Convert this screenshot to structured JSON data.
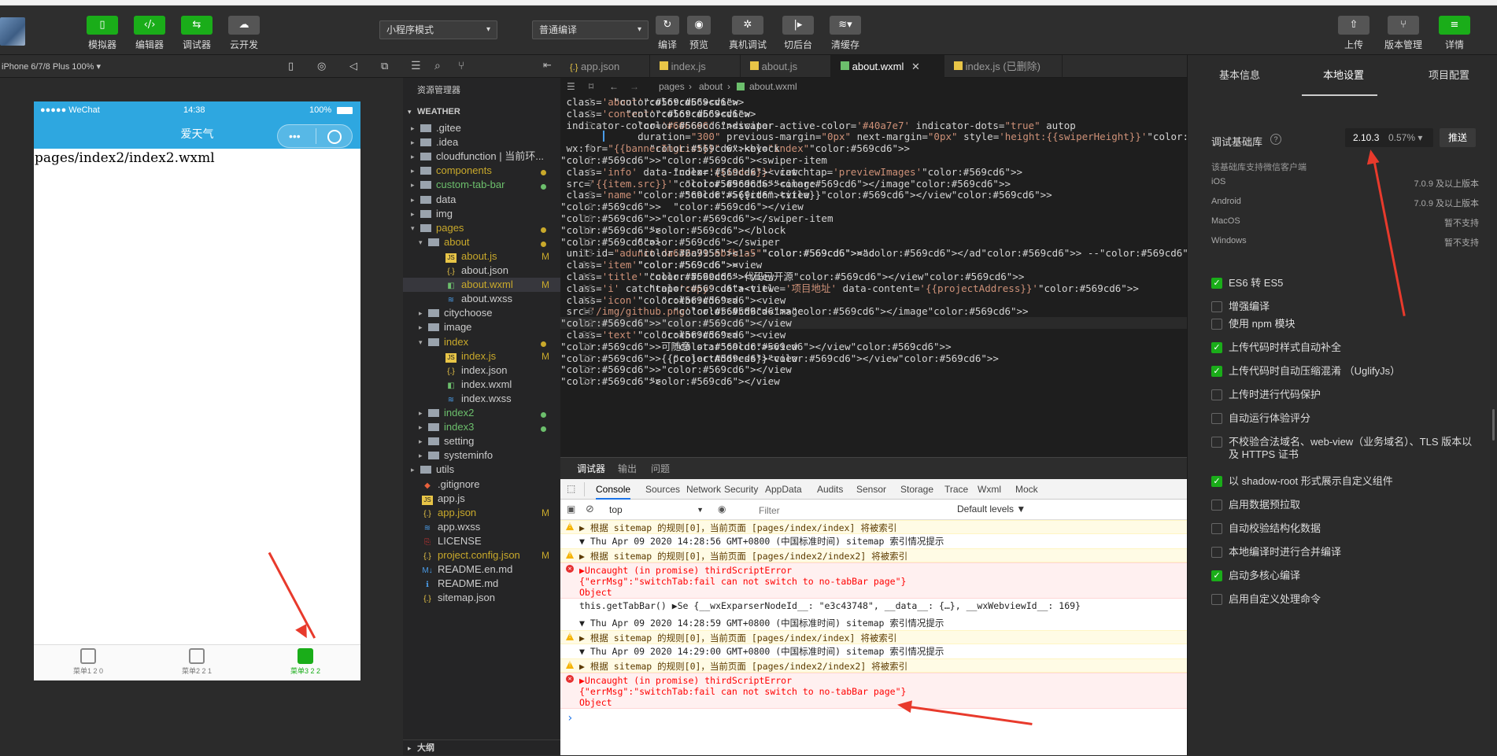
{
  "toolbar": {
    "left_buttons": [
      {
        "label": "模拟器",
        "icon": "phone-icon"
      },
      {
        "label": "编辑器",
        "icon": "code-icon"
      },
      {
        "label": "调试器",
        "icon": "debug-icon"
      },
      {
        "label": "云开发",
        "icon": "cloud-icon"
      }
    ],
    "mode_select": "小程序模式",
    "compile_select": "普通编译",
    "mid_buttons": [
      {
        "label": "编译",
        "icon": "refresh-icon"
      },
      {
        "label": "预览",
        "icon": "eye-icon"
      },
      {
        "label": "真机调试",
        "icon": "bug-icon"
      },
      {
        "label": "切后台",
        "icon": "switch-icon"
      },
      {
        "label": "清缓存",
        "icon": "layers-icon"
      }
    ],
    "right_buttons": [
      {
        "label": "上传",
        "icon": "upload-icon"
      },
      {
        "label": "版本管理",
        "icon": "branch-icon"
      },
      {
        "label": "详情",
        "icon": "menu-icon"
      }
    ]
  },
  "simulator": {
    "device": "iPhone 6/7/8 Plus 100% ▾",
    "status_left": "●●●●● WeChat",
    "status_time": "14:38",
    "status_battery": "100%",
    "nav_title": "爱天气",
    "page_text": "pages/index2/index2.wxml",
    "tabs": [
      {
        "label": "菜单1 2 0"
      },
      {
        "label": "菜单2 2 1"
      },
      {
        "label": "菜单3 2 2"
      }
    ]
  },
  "explorer": {
    "title": "资源管理器",
    "root": "WEATHER",
    "items": [
      {
        "name": ".gitee",
        "type": "folder",
        "depth": 1
      },
      {
        "name": ".idea",
        "type": "folder",
        "depth": 1
      },
      {
        "name": "cloudfunction | 当前环...",
        "type": "folder",
        "depth": 1
      },
      {
        "name": "components",
        "type": "folder",
        "depth": 1,
        "color": "#c9a92b"
      },
      {
        "name": "custom-tab-bar",
        "type": "folder",
        "depth": 1,
        "color": "#6cbf6c"
      },
      {
        "name": "data",
        "type": "folder",
        "depth": 1
      },
      {
        "name": "img",
        "type": "folder",
        "depth": 1
      },
      {
        "name": "pages",
        "type": "folder",
        "depth": 1,
        "color": "#c9a92b",
        "open": true
      },
      {
        "name": "about",
        "type": "folder",
        "depth": 2,
        "color": "#c9a92b",
        "open": true
      },
      {
        "name": "about.js",
        "type": "js",
        "depth": 3,
        "color": "#c9a92b",
        "badge": "M"
      },
      {
        "name": "about.json",
        "type": "json",
        "depth": 3
      },
      {
        "name": "about.wxml",
        "type": "wxml",
        "depth": 3,
        "color": "#c9a92b",
        "badge": "M",
        "selected": true
      },
      {
        "name": "about.wxss",
        "type": "wxss",
        "depth": 3
      },
      {
        "name": "citychoose",
        "type": "folder",
        "depth": 2
      },
      {
        "name": "image",
        "type": "folder",
        "depth": 2
      },
      {
        "name": "index",
        "type": "folder",
        "depth": 2,
        "color": "#c9a92b",
        "open": true
      },
      {
        "name": "index.js",
        "type": "js",
        "depth": 3,
        "color": "#c9a92b",
        "badge": "M"
      },
      {
        "name": "index.json",
        "type": "json",
        "depth": 3
      },
      {
        "name": "index.wxml",
        "type": "wxml",
        "depth": 3
      },
      {
        "name": "index.wxss",
        "type": "wxss",
        "depth": 3
      },
      {
        "name": "index2",
        "type": "folder",
        "depth": 2,
        "color": "#6cbf6c"
      },
      {
        "name": "index3",
        "type": "folder",
        "depth": 2,
        "color": "#6cbf6c"
      },
      {
        "name": "setting",
        "type": "folder",
        "depth": 2
      },
      {
        "name": "systeminfo",
        "type": "folder",
        "depth": 2
      },
      {
        "name": "utils",
        "type": "folder",
        "depth": 1
      },
      {
        "name": ".gitignore",
        "type": "git",
        "depth": 1
      },
      {
        "name": "app.js",
        "type": "js",
        "depth": 1
      },
      {
        "name": "app.json",
        "type": "json",
        "depth": 1,
        "color": "#c9a92b",
        "badge": "M"
      },
      {
        "name": "app.wxss",
        "type": "wxss",
        "depth": 1
      },
      {
        "name": "LICENSE",
        "type": "license",
        "depth": 1
      },
      {
        "name": "project.config.json",
        "type": "json",
        "depth": 1,
        "color": "#c9a92b",
        "badge": "M"
      },
      {
        "name": "README.en.md",
        "type": "md",
        "depth": 1
      },
      {
        "name": "README.md",
        "type": "info",
        "depth": 1
      },
      {
        "name": "sitemap.json",
        "type": "json",
        "depth": 1
      }
    ],
    "outline": "大纲"
  },
  "editor": {
    "tabs": [
      {
        "label": "app.json",
        "icon": "{.}"
      },
      {
        "label": "index.js",
        "icon": "JS"
      },
      {
        "label": "about.js",
        "icon": "JS"
      },
      {
        "label": "about.wxml",
        "icon": "◧",
        "active": true
      },
      {
        "label": "index.js (已删除)",
        "icon": "JS"
      }
    ],
    "breadcrumb": [
      "pages",
      "about",
      "about.wxml"
    ],
    "lines": [
      "<view class='about'>",
      "  <view class='content'>",
      "    <swiper indicator-color='#666666' indicator-active-color='#40a7e7' indicator-dots=\"true\" autop",
      "    duration=\"300\" previous-margin=\"0px\" next-margin=\"0px\" style='height:{{swiperHeight}}'>",
      "      <block wx:for=\"{{bannerImgList}}\" wx:key=\"index\">",
      "        <swiper-item>",
      "          <view class='info' data-index='{{index}}' catchtap='previewImages'>",
      "            <image src='{{item.src}}'></image>",
      "            <view class='name'>{{item.title}}</view>",
      "          </view>",
      "        </swiper-item>",
      "      </block>",
      "    </swiper>",
      "    <!-- <ad unit-id=\"adunit-da632c715ebfb1a5\"></ad> -->",
      "    <view class='item'>",
      "      <view class='title'>代码已开源</view>",
      "      <view class='i' catchtap='copy' data-title='项目地址' data-content='{{projectAddress}}'>",
      "        <view class='icon'>",
      "          <image src='/img/github.png'></image>",
      "        </view>",
      "        <view class='text'>",
      "          <view>可随意 star</view>",
      "          <view>{{projectAddress}}</view>",
      "        </view>",
      "      </view>"
    ],
    "line_numbers": [
      "1",
      "2",
      "3",
      "",
      "4",
      "5",
      "6",
      "7",
      "8",
      "9",
      "10",
      "11",
      "12",
      "13",
      "14",
      "15",
      "16",
      "17",
      "18",
      "19",
      "20",
      "21",
      "22",
      "23",
      "24"
    ]
  },
  "debug": {
    "panel_tabs": [
      "调试器",
      "输出",
      "问题"
    ],
    "console_tabs": [
      "Console",
      "Sources",
      "Network",
      "Security",
      "AppData",
      "Audits",
      "Sensor",
      "Storage",
      "Trace",
      "Wxml",
      "Mock"
    ],
    "context": "top",
    "filter_placeholder": "Filter",
    "levels": "Default levels ▼",
    "logs": [
      {
        "type": "warn",
        "text": "▶ 根据 sitemap 的规则[0]，当前页面 [pages/index/index] 将被索引"
      },
      {
        "type": "info",
        "text": "▼ Thu Apr 09 2020 14:28:56 GMT+0800 (中国标准时间) sitemap 索引情况提示"
      },
      {
        "type": "warn",
        "text": "▶ 根据 sitemap 的规则[0]，当前页面 [pages/index2/index2] 将被索引"
      },
      {
        "type": "err",
        "text": "▶Uncaught (in promise) thirdScriptError\n{\"errMsg\":\"switchTab:fail can not switch to no-tabBar page\"}\nObject"
      },
      {
        "type": "info",
        "text": "this.getTabBar() ▶Se {__wxExparserNodeId__: \"e3c43748\", __data__: {…}, __wxWebviewId__: 169}"
      },
      {
        "type": "info",
        "text": "▼ Thu Apr 09 2020 14:28:59 GMT+0800 (中国标准时间) sitemap 索引情况提示"
      },
      {
        "type": "warn",
        "text": "▶ 根据 sitemap 的规则[0]，当前页面 [pages/index/index] 将被索引"
      },
      {
        "type": "info",
        "text": "▼ Thu Apr 09 2020 14:29:00 GMT+0800 (中国标准时间) sitemap 索引情况提示"
      },
      {
        "type": "warn",
        "text": "▶ 根据 sitemap 的规则[0]，当前页面 [pages/index2/index2] 将被索引"
      },
      {
        "type": "err",
        "text": "▶Uncaught (in promise) thirdScriptError\n{\"errMsg\":\"switchTab:fail can not switch to no-tabBar page\"}\nObject"
      }
    ],
    "prompt": "›"
  },
  "settings": {
    "tabs": [
      "基本信息",
      "本地设置",
      "项目配置"
    ],
    "active_tab": "本地设置",
    "lib_label": "调试基础库",
    "lib_version": "2.10.3",
    "lib_percent": "0.57% ▾",
    "push_button": "推送",
    "support_title": "该基础库支持微信客户端",
    "platforms": [
      {
        "name": "iOS",
        "value": "7.0.9 及以上版本"
      },
      {
        "name": "Android",
        "value": "7.0.9 及以上版本"
      },
      {
        "name": "MacOS",
        "value": "暂不支持"
      },
      {
        "name": "Windows",
        "value": "暂不支持"
      }
    ],
    "options": [
      {
        "label": "ES6 转 ES5",
        "checked": true
      },
      {
        "label": "增强编译",
        "checked": false
      },
      {
        "label": "使用 npm 模块",
        "checked": false
      },
      {
        "label": "上传代码时样式自动补全",
        "checked": true
      },
      {
        "label": "上传代码时自动压缩混淆 （UglifyJs）",
        "checked": true
      },
      {
        "label": "上传时进行代码保护",
        "checked": false
      },
      {
        "label": "自动运行体验评分",
        "checked": false
      },
      {
        "label": "不校验合法域名、web-view（业务域名）、TLS 版本以及 HTTPS 证书",
        "checked": false
      },
      {
        "label": "以 shadow-root 形式展示自定义组件",
        "checked": true
      },
      {
        "label": "启用数据预拉取",
        "checked": false
      },
      {
        "label": "自动校验结构化数据",
        "checked": false
      },
      {
        "label": "本地编译时进行合并编译",
        "checked": false
      },
      {
        "label": "启动多核心编译",
        "checked": true
      },
      {
        "label": "启用自定义处理命令",
        "checked": false
      }
    ]
  },
  "colors": {
    "accent_green": "#1aad19",
    "nav_blue": "#2ea7e0",
    "annotation_red": "#e83a2c"
  }
}
